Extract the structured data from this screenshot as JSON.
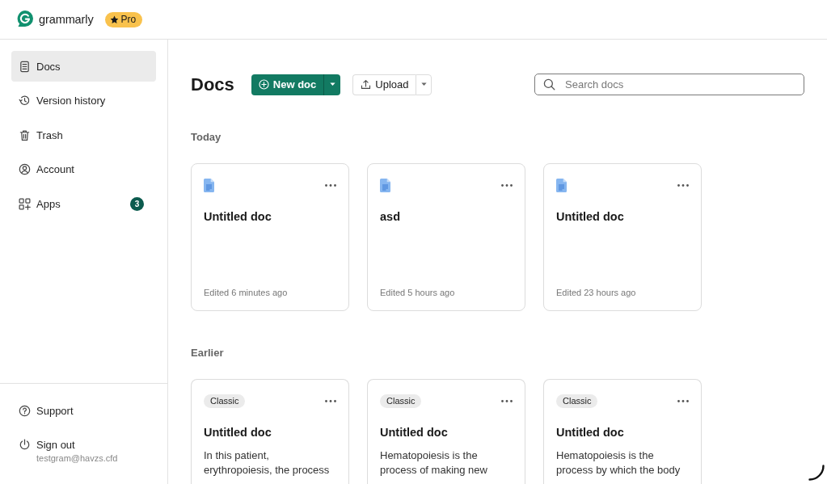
{
  "header": {
    "logo_text": "grammarly",
    "plan_badge": "Pro"
  },
  "sidebar": {
    "items": [
      {
        "label": "Docs",
        "selected": true
      },
      {
        "label": "Version history",
        "selected": false
      },
      {
        "label": "Trash",
        "selected": false
      },
      {
        "label": "Account",
        "selected": false
      },
      {
        "label": "Apps",
        "selected": false,
        "badge": "3"
      }
    ],
    "footer": {
      "support": "Support",
      "sign_out": "Sign out",
      "account_email": "testgram@havzs.cfd"
    }
  },
  "toolbar": {
    "title": "Docs",
    "new_doc_button": "New doc",
    "upload_button": "Upload",
    "search": {
      "placeholder": "Search docs"
    }
  },
  "sections": [
    {
      "heading": "Today",
      "docs": [
        {
          "title": "Untitled doc",
          "edited": "Edited 6 minutes ago"
        },
        {
          "title": "asd",
          "edited": "Edited 5 hours ago"
        },
        {
          "title": "Untitled doc",
          "edited": "Edited 23 hours ago"
        }
      ]
    },
    {
      "heading": "Earlier",
      "docs": [
        {
          "tag": "Classic",
          "title": "Untitled doc",
          "preview": "In this patient, erythropoiesis, the process"
        },
        {
          "tag": "Classic",
          "title": "Untitled doc",
          "preview": "Hematopoiesis is the process of making new"
        },
        {
          "tag": "Classic",
          "title": "Untitled doc",
          "preview": "Hematopoiesis is the process by which the body"
        }
      ]
    }
  ]
}
